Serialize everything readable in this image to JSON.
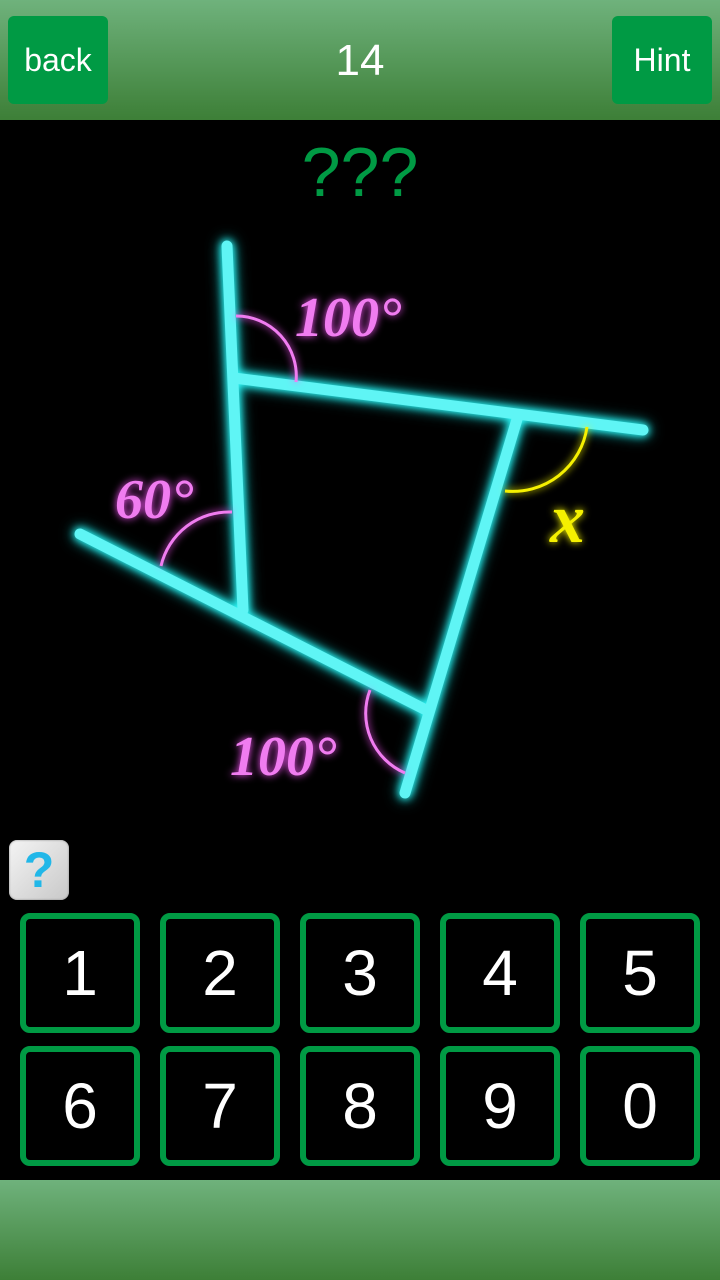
{
  "header": {
    "back_label": "back",
    "level": "14",
    "hint_label": "Hint"
  },
  "puzzle": {
    "answer_display": "???",
    "angle_labels": {
      "top": "100°",
      "left": "60°",
      "bottom": "100°",
      "unknown": "x"
    },
    "colors": {
      "lines": "#5ff5f5",
      "given_angles": "#f07cf0",
      "unknown_angle": "#f5f000",
      "answer": "#009a44"
    }
  },
  "help_icon": "question-mark-icon",
  "keypad": {
    "keys": [
      "1",
      "2",
      "3",
      "4",
      "5",
      "6",
      "7",
      "8",
      "9",
      "0"
    ]
  }
}
